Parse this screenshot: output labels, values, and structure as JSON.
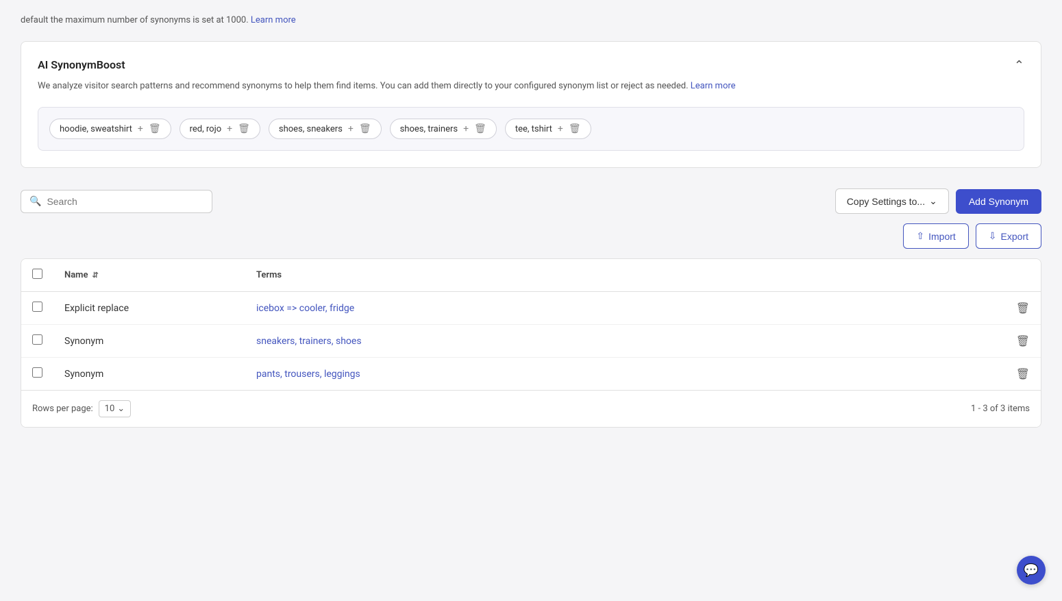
{
  "top_notice": {
    "text": "default the maximum number of synonyms is set at 1000.",
    "link_text": "Learn more",
    "link_url": "#"
  },
  "ai_synonym_boost": {
    "title": "AI SynonymBoost",
    "description": "We analyze visitor search patterns and recommend synonyms to help them find items. You can add them directly to your configured synonym list or reject as needed.",
    "learn_more_text": "Learn more",
    "chips": [
      {
        "label": "hoodie, sweatshirt"
      },
      {
        "label": "red, rojo"
      },
      {
        "label": "shoes, sneakers"
      },
      {
        "label": "shoes, trainers"
      },
      {
        "label": "tee, tshirt"
      }
    ]
  },
  "toolbar": {
    "copy_settings_label": "Copy Settings to...",
    "add_synonym_label": "Add Synonym",
    "search_placeholder": "Search",
    "import_label": "Import",
    "export_label": "Export"
  },
  "table": {
    "columns": {
      "name": "Name",
      "terms": "Terms"
    },
    "rows": [
      {
        "type": "Explicit replace",
        "terms": "icebox => cooler, fridge"
      },
      {
        "type": "Synonym",
        "terms": "sneakers, trainers, shoes"
      },
      {
        "type": "Synonym",
        "terms": "pants, trousers, leggings"
      }
    ]
  },
  "footer": {
    "rows_per_page_label": "Rows per page:",
    "rows_per_page_value": "10",
    "pagination_text": "1 - 3 of 3 items"
  },
  "chat_icon": "💬"
}
